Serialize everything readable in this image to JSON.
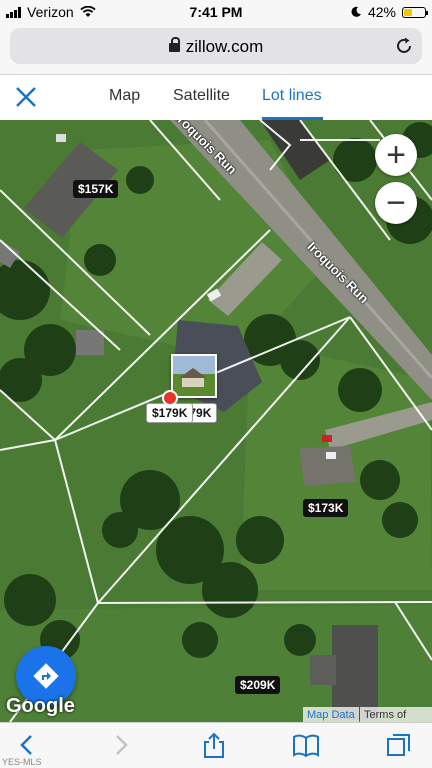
{
  "status": {
    "carrier": "Verizon",
    "time": "7:41 PM",
    "battery": "42%",
    "battery_level": 0.42
  },
  "browser": {
    "url": "zillow.com"
  },
  "tabs": [
    {
      "label": "Map",
      "active": false
    },
    {
      "label": "Satellite",
      "active": false
    },
    {
      "label": "Lot lines",
      "active": true
    }
  ],
  "map": {
    "road_labels": [
      "Iroquois Run",
      "Iroquois Run"
    ],
    "prices": [
      "$157K",
      "$179K",
      "$179K",
      "$173K",
      "$209K"
    ],
    "zoom_in": "+",
    "zoom_out": "−",
    "logo": "Google",
    "map_data": "Map Data",
    "terms": "Terms of Use"
  },
  "watermark": "YES-MLS",
  "colors": {
    "accent": "#1a73c6",
    "fab": "#1a73e8",
    "marker": "#e8352c"
  }
}
